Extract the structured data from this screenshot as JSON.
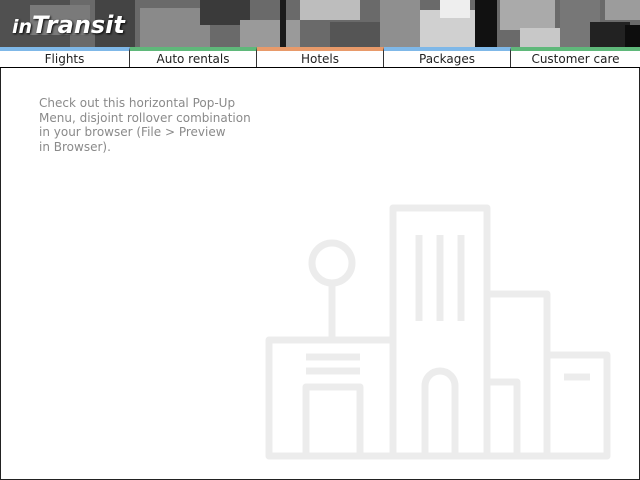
{
  "brand": {
    "prefix": "in",
    "name": "Transit"
  },
  "nav": {
    "items": [
      {
        "label": "Flights",
        "color": "#7fb8e8"
      },
      {
        "label": "Auto rentals",
        "color": "#5fb87a"
      },
      {
        "label": "Hotels",
        "color": "#e89a6a"
      },
      {
        "label": "Packages",
        "color": "#7fb8e8"
      },
      {
        "label": "Customer care",
        "color": "#5fb87a"
      }
    ]
  },
  "main": {
    "lines": [
      "Check out this horizontal Pop-Up",
      "Menu, disjoint rollover combination",
      "in your browser (File > Preview",
      "in Browser)."
    ]
  },
  "illustration": {
    "icon": "city-buildings-icon",
    "color": "#ececec"
  }
}
